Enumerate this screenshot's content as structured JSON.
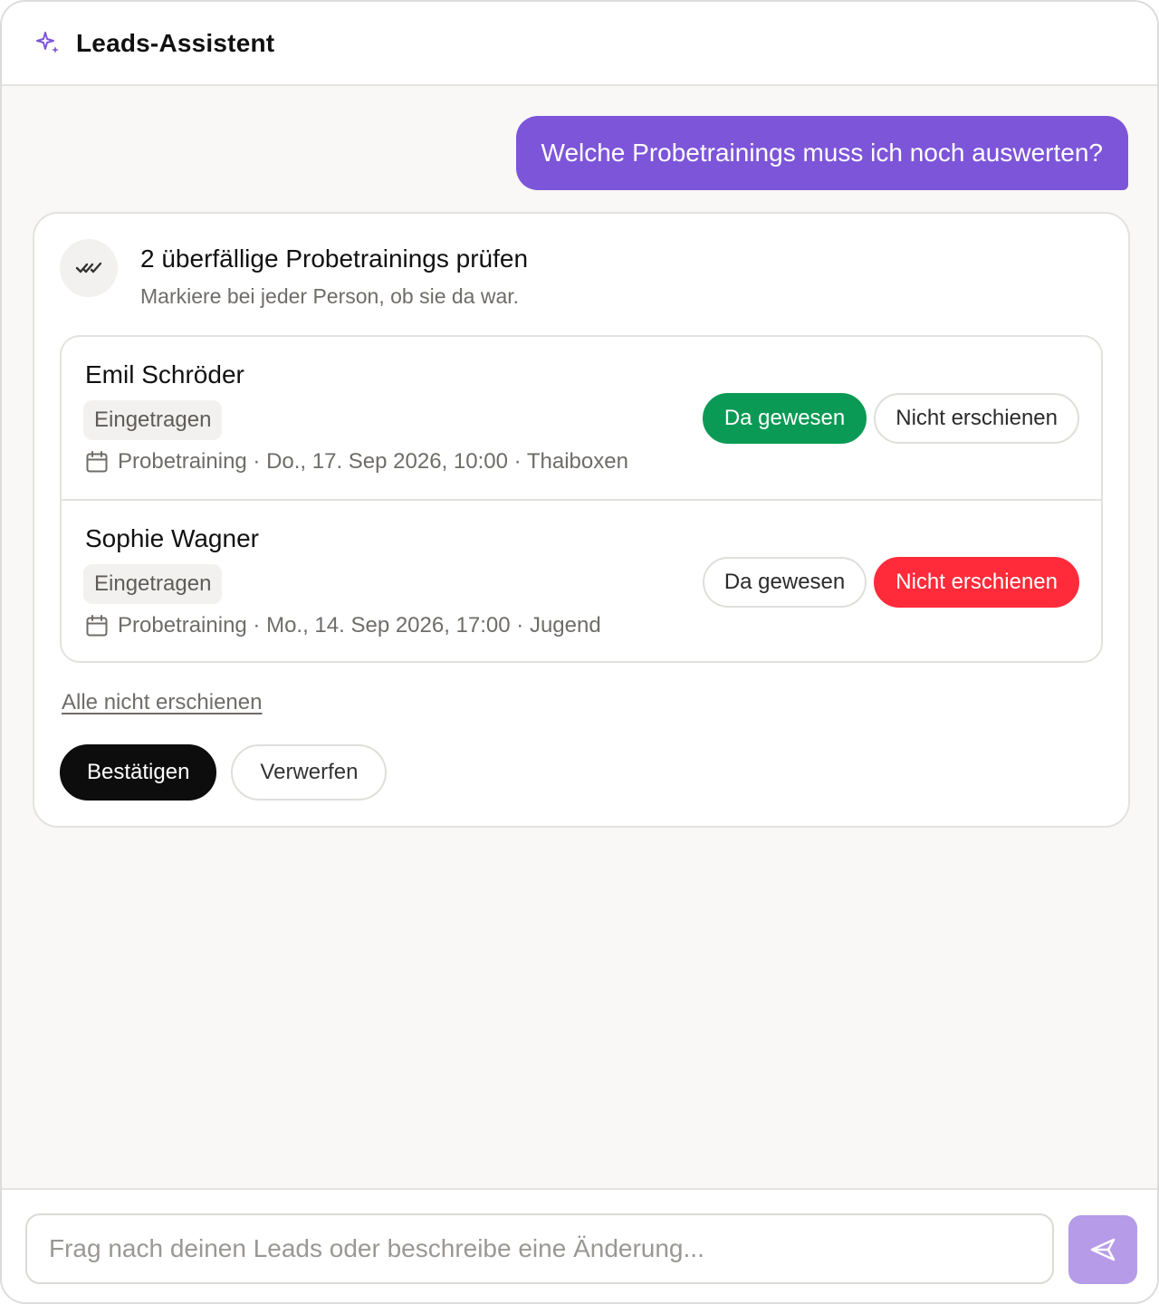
{
  "header": {
    "title": "Leads-Assistent",
    "icon": "sparkle-icon",
    "accent": "#7d55d9"
  },
  "user_message": "Welche Probetrainings muss ich noch auswerten?",
  "card": {
    "icon": "double-check-icon",
    "title": "2 überfällige Probetrainings prüfen",
    "subtitle": "Markiere bei jeder Person, ob sie da war.",
    "items": [
      {
        "name": "Emil Schröder",
        "badge": "Eingetragen",
        "meta": "Probetraining · Do., 17. Sep 2026, 10:00 · Thaiboxen",
        "attended_label": "Da gewesen",
        "no_show_label": "Nicht erschienen",
        "selected": "attended"
      },
      {
        "name": "Sophie Wagner",
        "badge": "Eingetragen",
        "meta": "Probetraining · Mo., 14. Sep 2026, 17:00 · Jugend",
        "attended_label": "Da gewesen",
        "no_show_label": "Nicht erschienen",
        "selected": "no_show"
      }
    ],
    "all_no_show_link": "Alle nicht erschienen",
    "confirm_label": "Bestätigen",
    "discard_label": "Verwerfen"
  },
  "composer": {
    "placeholder": "Frag nach deinen Leads oder beschreibe eine Änderung...",
    "send_icon": "send-icon"
  },
  "colors": {
    "attended": "#0b9a55",
    "no_show": "#ff2b3a",
    "user_bubble": "#7d55d9",
    "send_button": "#b59be8"
  }
}
